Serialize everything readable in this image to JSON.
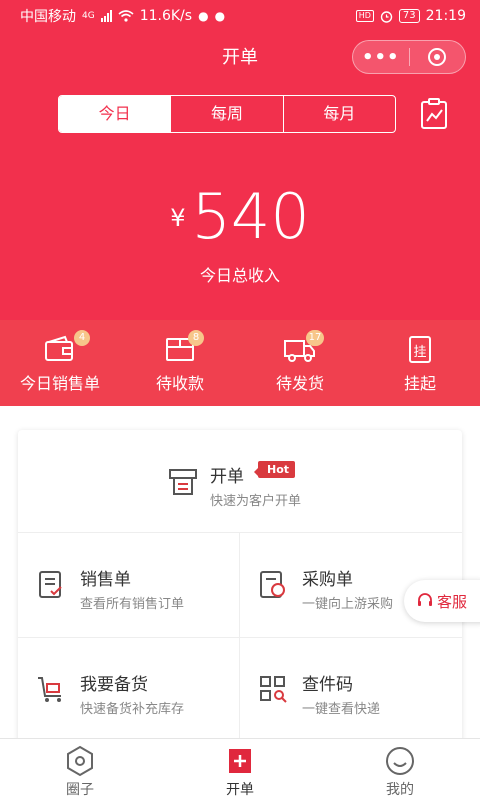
{
  "status_bar": {
    "carrier": "中国移动",
    "net_label": "4G",
    "speed": "11.6K/s",
    "hd_label": "HD",
    "battery": "73",
    "time": "21:19"
  },
  "header": {
    "title": "开单",
    "more_label": "•••"
  },
  "period_tabs": [
    {
      "label": "今日",
      "active": true
    },
    {
      "label": "每周",
      "active": false
    },
    {
      "label": "每月",
      "active": false
    }
  ],
  "summary": {
    "currency": "¥",
    "amount": "540",
    "label": "今日总收入"
  },
  "quick_actions": [
    {
      "label": "今日销售单",
      "badge": "4",
      "icon": "wallet-icon"
    },
    {
      "label": "待收款",
      "badge": "8",
      "icon": "package-icon"
    },
    {
      "label": "待发货",
      "badge": "17",
      "icon": "truck-icon"
    },
    {
      "label": "挂起",
      "badge": "",
      "icon": "clipboard-icon",
      "glyph": "挂"
    }
  ],
  "featured": {
    "title": "开单",
    "tag": "Hot",
    "desc": "快速为客户开单",
    "icon": "printer-icon"
  },
  "grid": [
    {
      "title": "销售单",
      "desc": "查看所有销售订单",
      "icon": "document-check-icon"
    },
    {
      "title": "采购单",
      "desc": "一键向上游采购",
      "icon": "purchase-icon"
    },
    {
      "title": "我要备货",
      "desc": "快速备货补充库存",
      "icon": "cart-icon"
    },
    {
      "title": "查件码",
      "desc": "一键查看快递",
      "icon": "qr-search-icon"
    }
  ],
  "float_button": {
    "label": "客服",
    "icon": "headset-icon"
  },
  "tabbar": [
    {
      "label": "圈子",
      "icon": "hexagon-icon",
      "active": false
    },
    {
      "label": "开单",
      "icon": "add-doc-icon",
      "active": true
    },
    {
      "label": "我的",
      "icon": "smile-icon",
      "active": false
    }
  ],
  "colors": {
    "primary": "#f2304d",
    "strip": "#f0404f",
    "badge": "#f7c68a",
    "hot": "#d93a3f"
  }
}
